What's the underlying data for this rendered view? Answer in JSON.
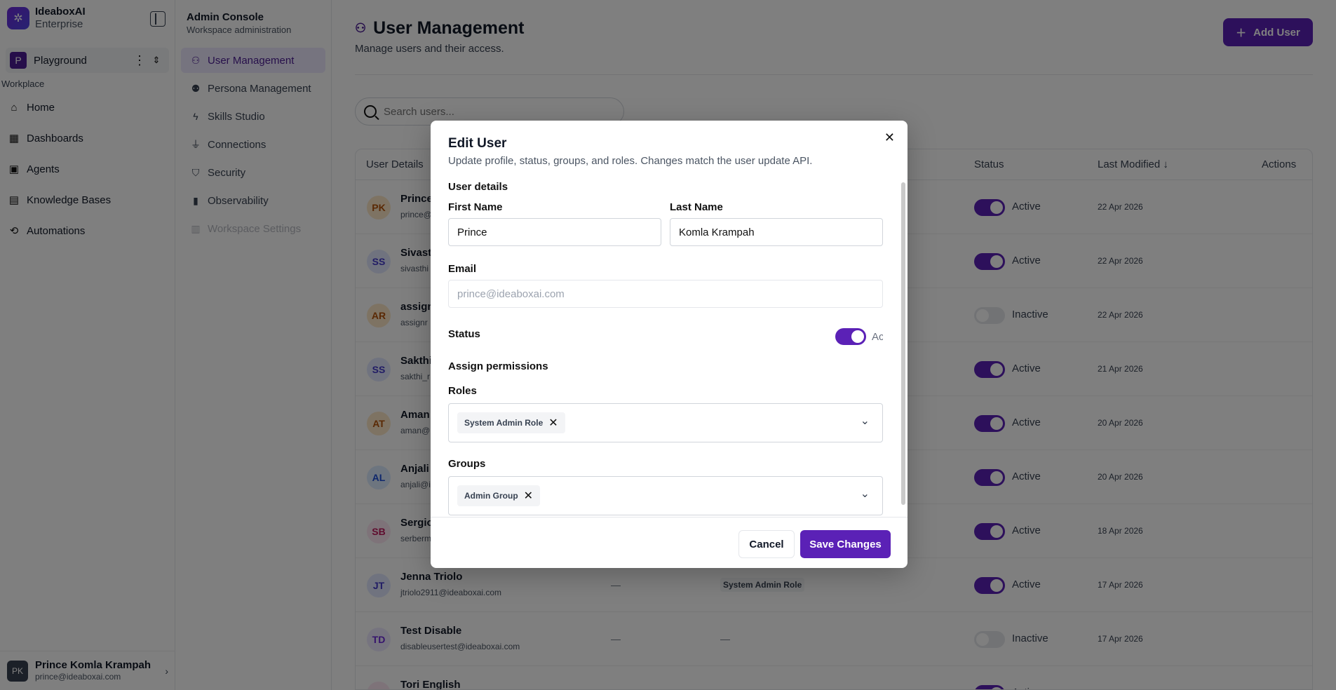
{
  "brand": {
    "name": "IdeaboxAI",
    "sub": "Enterprise"
  },
  "workspace": {
    "initial": "P",
    "name": "Playground"
  },
  "nav": {
    "section": "Workplace",
    "items": [
      {
        "label": "Home",
        "icon": "home-icon"
      },
      {
        "label": "Dashboards",
        "icon": "grid-icon"
      },
      {
        "label": "Agents",
        "icon": "bot-icon"
      },
      {
        "label": "Knowledge Bases",
        "icon": "book-icon"
      },
      {
        "label": "Automations",
        "icon": "workflow-icon"
      }
    ]
  },
  "current_user": {
    "initials": "PK",
    "name": "Prince Komla Krampah",
    "email": "prince@ideaboxai.com"
  },
  "admin": {
    "title": "Admin Console",
    "sub": "Workspace administration",
    "items": [
      {
        "label": "User Management"
      },
      {
        "label": "Persona Management"
      },
      {
        "label": "Skills Studio"
      },
      {
        "label": "Connections"
      },
      {
        "label": "Security"
      },
      {
        "label": "Observability"
      },
      {
        "label": "Workspace Settings"
      }
    ]
  },
  "page": {
    "title": "User Management",
    "subtitle": "Manage users and their access.",
    "add_user_label": "Add User",
    "search_placeholder": "Search users..."
  },
  "table": {
    "headers": {
      "user": "User Details",
      "status": "Status",
      "modified": "Last Modified",
      "actions": "Actions"
    },
    "rows": [
      {
        "initials": "PK",
        "name": "Prince",
        "email": "prince@",
        "status": "Active",
        "on": true,
        "date": "22 Apr 2026",
        "bg": "#fde7c7",
        "fg": "#b45309"
      },
      {
        "initials": "SS",
        "name": "Sivasth",
        "email": "sivasthi",
        "status": "Active",
        "on": true,
        "date": "22 Apr 2026",
        "bg": "#e0e7ff",
        "fg": "#4338ca"
      },
      {
        "initials": "AR",
        "name": "assign",
        "email": "assignr",
        "status": "Inactive",
        "on": false,
        "date": "22 Apr 2026",
        "bg": "#fde7c7",
        "fg": "#b45309"
      },
      {
        "initials": "SS",
        "name": "Sakthi",
        "email": "sakthi_r",
        "status": "Active",
        "on": true,
        "date": "21 Apr 2026",
        "bg": "#e0e7ff",
        "fg": "#4338ca"
      },
      {
        "initials": "AT",
        "name": "Aman",
        "email": "aman@",
        "status": "Active",
        "on": true,
        "date": "20 Apr 2026",
        "bg": "#fde7c7",
        "fg": "#b45309"
      },
      {
        "initials": "AL",
        "name": "Anjali I",
        "email": "anjali@i",
        "status": "Active",
        "on": true,
        "date": "20 Apr 2026",
        "bg": "#dbeafe",
        "fg": "#1d4ed8"
      },
      {
        "initials": "SB",
        "name": "Sergio",
        "email": "serberm",
        "status": "Active",
        "on": true,
        "date": "18 Apr 2026",
        "bg": "#fce7f3",
        "fg": "#be185d"
      },
      {
        "initials": "JT",
        "name": "Jenna Triolo",
        "email": "jtriolo2911@ideaboxai.com",
        "dash": "—",
        "role": "System Admin Role",
        "status": "Active",
        "on": true,
        "date": "17 Apr 2026",
        "bg": "#e0e7ff",
        "fg": "#4338ca"
      },
      {
        "initials": "TD",
        "name": "Test Disable",
        "email": "disableusertest@ideaboxai.com",
        "dash": "—",
        "role_plain": "—",
        "status": "Inactive",
        "on": false,
        "date": "17 Apr 2026",
        "bg": "#ede9fe",
        "fg": "#6d28d9"
      },
      {
        "initials": "TE",
        "name": "Tori English",
        "email": "",
        "status": "Active",
        "on": true,
        "date": "",
        "bg": "#fce7f3",
        "fg": "#be185d"
      }
    ]
  },
  "modal": {
    "title": "Edit User",
    "subtitle": "Update profile, status, groups, and roles. Changes match the user update API.",
    "details_title": "User details",
    "first_name_label": "First Name",
    "first_name": "Prince",
    "last_name_label": "Last Name",
    "last_name": "Komla Krampah",
    "email_label": "Email",
    "email": "prince@ideaboxai.com",
    "status_label": "Status",
    "status_value": "Active",
    "permissions_title": "Assign permissions",
    "roles_label": "Roles",
    "role_chip": "System Admin Role",
    "groups_label": "Groups",
    "group_chip": "Admin Group",
    "cancel_label": "Cancel",
    "save_label": "Save Changes"
  }
}
